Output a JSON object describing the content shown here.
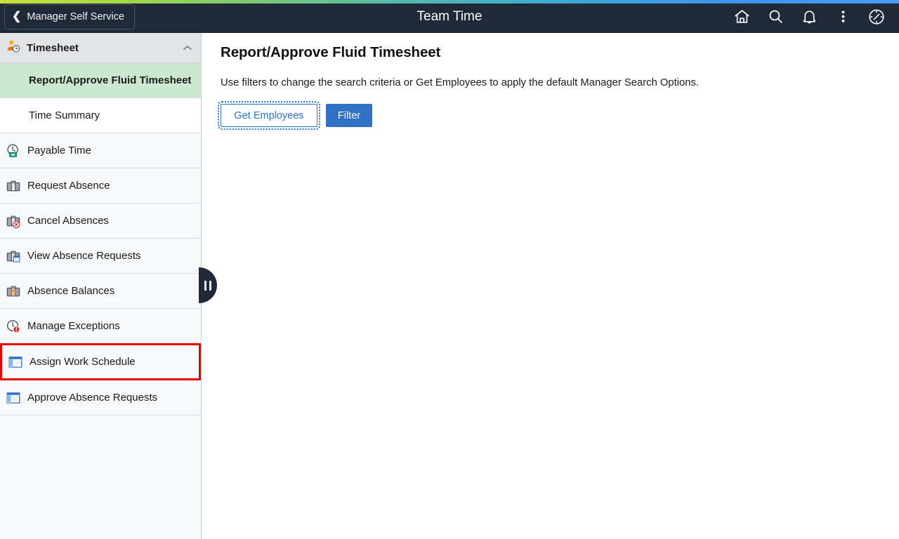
{
  "header": {
    "back_label": "Manager Self Service",
    "title": "Team Time",
    "icons": [
      {
        "name": "home-icon",
        "title": "Home"
      },
      {
        "name": "search-icon",
        "title": "Search"
      },
      {
        "name": "notifications-bell-icon",
        "title": "Notifications"
      },
      {
        "name": "actions-kebab-icon",
        "title": "Actions"
      },
      {
        "name": "navbar-compass-icon",
        "title": "NavBar"
      }
    ],
    "background_color": "#1f2937",
    "gradient_from": "#c8e33a",
    "gradient_to": "#4a9bff"
  },
  "sidebar": {
    "group": {
      "label": "Timesheet",
      "icon": "person-clock-icon",
      "expanded": true,
      "caret": "⌃"
    },
    "subitems": [
      {
        "label": "Report/Approve Fluid Timesheet",
        "selected": true
      },
      {
        "label": "Time Summary",
        "selected": false
      }
    ],
    "items": [
      {
        "label": "Payable Time",
        "icon": "clock-money-icon",
        "highlighted": false
      },
      {
        "label": "Request Absence",
        "icon": "briefcase-icon",
        "highlighted": false
      },
      {
        "label": "Cancel Absences",
        "icon": "briefcase-cancel-icon",
        "highlighted": false
      },
      {
        "label": "View Absence Requests",
        "icon": "briefcase-calendar-icon",
        "highlighted": false
      },
      {
        "label": "Absence Balances",
        "icon": "briefcase-balance-icon",
        "highlighted": false
      },
      {
        "label": "Manage Exceptions",
        "icon": "clock-alert-icon",
        "highlighted": false
      },
      {
        "label": "Assign Work Schedule",
        "icon": "window-panel-icon",
        "highlighted": true
      },
      {
        "label": "Approve Absence Requests",
        "icon": "window-panel-icon",
        "highlighted": false
      }
    ],
    "selected_highlight_color": "#c9e8ce",
    "annotation_box_color": "#ee0000"
  },
  "collapse_handle": {
    "name": "sidebar-collapse-handle",
    "glyph": "||"
  },
  "main": {
    "page_title": "Report/Approve Fluid Timesheet",
    "instructions": "Use filters to change the search criteria or Get Employees to apply the default Manager Search Options.",
    "buttons": {
      "get_employees": "Get Employees",
      "filter": "Filter"
    },
    "accent_color": "#2f72c4"
  }
}
